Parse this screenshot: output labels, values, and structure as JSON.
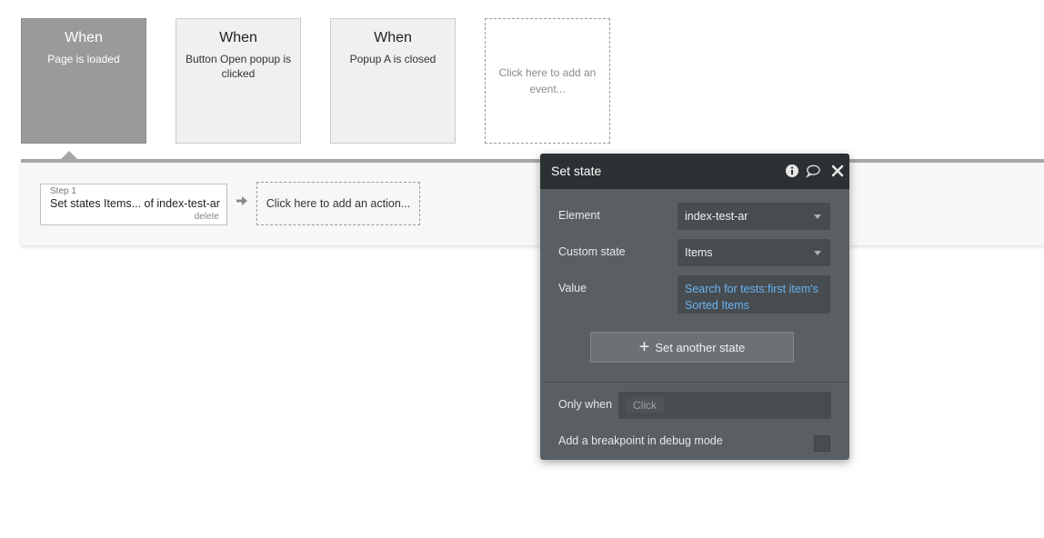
{
  "events": [
    {
      "when": "When",
      "description": "Page is loaded",
      "selected": true
    },
    {
      "when": "When",
      "description": "Button Open popup is clicked",
      "selected": false
    },
    {
      "when": "When",
      "description": "Popup A is closed",
      "selected": false
    }
  ],
  "add_event_label": "Click here to add an event...",
  "workflow": {
    "step": {
      "label": "Step 1",
      "title": "Set states Items... of index-test-ar",
      "delete_label": "delete"
    },
    "add_action_label": "Click here to add an action..."
  },
  "panel": {
    "title": "Set state",
    "icons": [
      "info-icon",
      "comment-icon",
      "close-icon"
    ],
    "element_label": "Element",
    "element_value": "index-test-ar",
    "custom_state_label": "Custom state",
    "custom_state_value": "Items",
    "value_label": "Value",
    "value_expression": "Search for tests:first item's Sorted Items",
    "add_state_label": "Set another state",
    "only_when_label": "Only when",
    "only_when_placeholder": "Click",
    "breakpoint_label": "Add a breakpoint in debug mode",
    "breakpoint_checked": false
  },
  "colors": {
    "panel_bg": "#5a5f63",
    "panel_header": "#2b3133",
    "expression_blue": "#6ab3f3",
    "selected_event": "#9a9a9a"
  }
}
